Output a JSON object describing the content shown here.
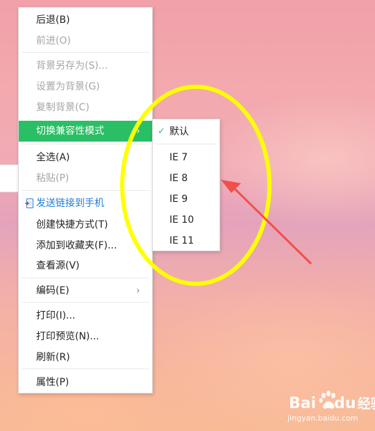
{
  "context_menu": {
    "items": [
      {
        "label": "后退(B)",
        "state": "normal"
      },
      {
        "label": "前进(O)",
        "state": "disabled"
      },
      {
        "label": "背景另存为(S)...",
        "state": "disabled"
      },
      {
        "label": "设置为背景(G)",
        "state": "disabled"
      },
      {
        "label": "复制背景(C)",
        "state": "disabled"
      },
      {
        "label": "切换兼容性模式",
        "state": "highlighted",
        "has_submenu": true
      },
      {
        "label": "全选(A)",
        "state": "normal"
      },
      {
        "label": "粘贴(P)",
        "state": "disabled"
      },
      {
        "label": "发送链接到手机",
        "state": "link",
        "icon": "phone-send-icon"
      },
      {
        "label": "创建快捷方式(T)",
        "state": "normal"
      },
      {
        "label": "添加到收藏夹(F)...",
        "state": "normal"
      },
      {
        "label": "查看源(V)",
        "state": "normal"
      },
      {
        "label": "编码(E)",
        "state": "normal",
        "has_submenu": true
      },
      {
        "label": "打印(I)...",
        "state": "normal"
      },
      {
        "label": "打印预览(N)...",
        "state": "normal"
      },
      {
        "label": "刷新(R)",
        "state": "normal"
      },
      {
        "label": "属性(P)",
        "state": "normal"
      }
    ]
  },
  "submenu": {
    "items": [
      {
        "label": "默认",
        "checked": true
      },
      {
        "label": "IE 7",
        "checked": false
      },
      {
        "label": "IE 8",
        "checked": false
      },
      {
        "label": "IE 9",
        "checked": false
      },
      {
        "label": "IE 10",
        "checked": false
      },
      {
        "label": "IE 11",
        "checked": false
      }
    ]
  },
  "icons": {
    "submenu_arrow": "chevron-right-icon",
    "check": "check-icon",
    "send_to_phone": "phone-send-icon"
  },
  "annotation": {
    "circle_color": "#ffff00",
    "arrow_color": "#f0504a"
  },
  "colors": {
    "highlight": "#2bbf65",
    "link": "#1f7cd6",
    "disabled_text": "#a6a6a6"
  },
  "watermark": {
    "brand": "Bai",
    "brand2": "du",
    "suffix": "经验",
    "url": "jingyan.baidu.com"
  }
}
